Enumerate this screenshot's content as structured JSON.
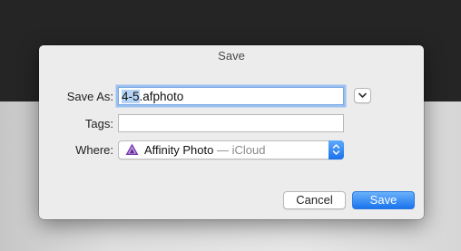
{
  "dialog": {
    "title": "Save",
    "save_as": {
      "label": "Save As:",
      "value_selected": "4-5",
      "value_rest": ".afphoto"
    },
    "tags": {
      "label": "Tags:",
      "value": ""
    },
    "where": {
      "label": "Where:",
      "location": "Affinity Photo",
      "suffix": " — iCloud",
      "icon": "affinity-photo-app-icon"
    },
    "buttons": {
      "cancel": "Cancel",
      "save": "Save"
    }
  },
  "colors": {
    "accent": "#1b74ee",
    "selection": "#b4d3f5",
    "affinity_purple": "#7a3fb0"
  }
}
